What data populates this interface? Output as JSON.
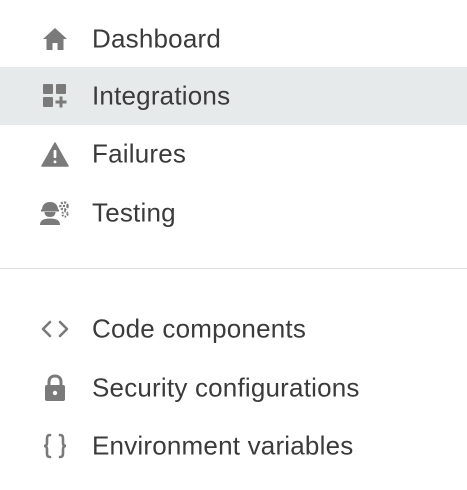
{
  "nav": {
    "primary": [
      {
        "label": "Dashboard",
        "icon": "home-icon"
      },
      {
        "label": "Integrations",
        "icon": "widgets-add-icon",
        "active": true
      },
      {
        "label": "Failures",
        "icon": "warning-icon"
      },
      {
        "label": "Testing",
        "icon": "engineer-icon"
      }
    ],
    "secondary": [
      {
        "label": "Code components",
        "icon": "code-icon",
        "glyph": "<>"
      },
      {
        "label": "Security configurations",
        "icon": "lock-icon"
      },
      {
        "label": "Environment variables",
        "icon": "braces-icon",
        "glyph": "{}"
      }
    ]
  },
  "colors": {
    "icon": "#7a7a7a",
    "text": "#3b3b3b",
    "active_bg": "#e6eaea",
    "divider": "#dedede"
  }
}
